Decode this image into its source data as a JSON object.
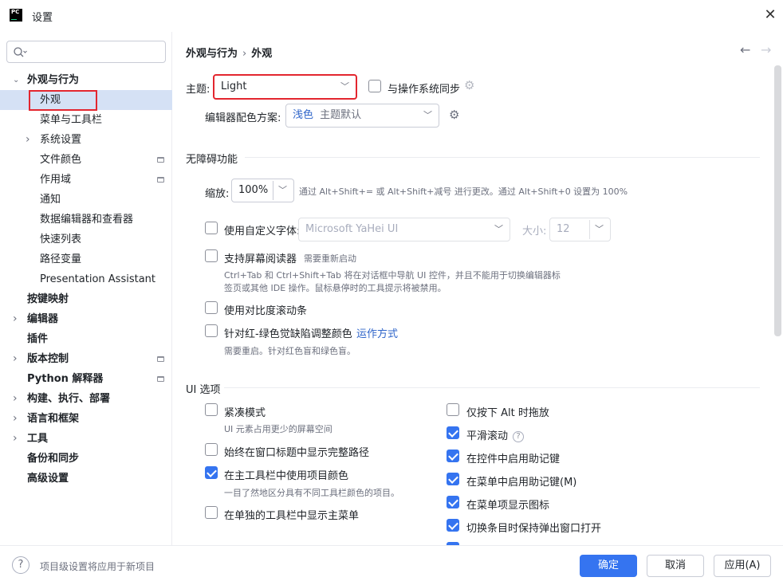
{
  "window": {
    "app_logo": "PC",
    "title": "设置",
    "close": "✕"
  },
  "search": {
    "placeholder": ""
  },
  "tree": [
    {
      "label": "外观与行为",
      "level": 0,
      "chevron": "expanded"
    },
    {
      "label": "外观",
      "level": 1,
      "selected": true
    },
    {
      "label": "菜单与工具栏",
      "level": 1
    },
    {
      "label": "系统设置",
      "level": 1,
      "chevron": "collapsed"
    },
    {
      "label": "文件颜色",
      "level": 1,
      "project_icon": true
    },
    {
      "label": "作用域",
      "level": 1,
      "project_icon": true
    },
    {
      "label": "通知",
      "level": 1
    },
    {
      "label": "数据编辑器和查看器",
      "level": 1
    },
    {
      "label": "快速列表",
      "level": 1
    },
    {
      "label": "路径变量",
      "level": 1
    },
    {
      "label": "Presentation Assistant",
      "level": 1
    },
    {
      "label": "按键映射",
      "level": 0
    },
    {
      "label": "编辑器",
      "level": 0,
      "chevron": "collapsed"
    },
    {
      "label": "插件",
      "level": 0
    },
    {
      "label": "版本控制",
      "level": 0,
      "chevron": "collapsed",
      "project_icon": true
    },
    {
      "label": "Python 解释器",
      "level": 0,
      "project_icon": true
    },
    {
      "label": "构建、执行、部署",
      "level": 0,
      "chevron": "collapsed"
    },
    {
      "label": "语言和框架",
      "level": 0,
      "chevron": "collapsed"
    },
    {
      "label": "工具",
      "level": 0,
      "chevron": "collapsed"
    },
    {
      "label": "备份和同步",
      "level": 0
    },
    {
      "label": "高级设置",
      "level": 0
    }
  ],
  "breadcrumb": {
    "parent": "外观与行为",
    "separator": "›",
    "current": "外观"
  },
  "nav": {
    "back": "←",
    "forward": "→"
  },
  "theme": {
    "label": "主题:",
    "value": "Light",
    "sync_label": "与操作系统同步",
    "sync_checked": false
  },
  "editor_scheme": {
    "label": "编辑器配色方案:",
    "value_prefix": "浅色",
    "value_suffix": "主题默认"
  },
  "accessibility": {
    "title": "无障碍功能",
    "zoom_label": "缩放:",
    "zoom_value": "100%",
    "zoom_hint": "通过 Alt+Shift+= 或 Alt+Shift+减号 进行更改。通过 Alt+Shift+0 设置为 100%",
    "custom_font": {
      "label": "使用自定义字体:",
      "checked": false,
      "font": "Microsoft YaHei UI",
      "size_label": "大小:",
      "size": "12"
    },
    "screen_reader": {
      "label": "支持屏幕阅读器",
      "checked": false,
      "restart_hint": "需要重新启动",
      "hint_line1": "Ctrl+Tab 和 Ctrl+Shift+Tab 将在对话框中导航 UI 控件，并且不能用于切换编辑器标",
      "hint_line2": "签页或其他 IDE 操作。鼠标悬停时的工具提示将被禁用。"
    },
    "contrast_scrollbars": {
      "label": "使用对比度滚动条",
      "checked": false
    },
    "color_deficiency": {
      "label": "针对红-绿色觉缺陷调整颜色",
      "checked": false,
      "link": "运作方式",
      "hint": "需要重启。针对红色盲和绿色盲。"
    }
  },
  "ui_options": {
    "title": "UI 选项",
    "left": [
      {
        "label": "紧凑模式",
        "checked": false,
        "hint": "UI 元素占用更少的屏幕空间"
      },
      {
        "label": "始终在窗口标题中显示完整路径",
        "checked": false
      },
      {
        "label": "在主工具栏中使用项目颜色",
        "checked": true,
        "hint": "一目了然地区分具有不同工具栏颜色的项目。"
      },
      {
        "label": "在单独的工具栏中显示主菜单",
        "checked": false
      }
    ],
    "right": [
      {
        "label": "仅按下 Alt 时拖放",
        "checked": false
      },
      {
        "label": "平滑滚动",
        "checked": true,
        "help": "?"
      },
      {
        "label": "在控件中启用助记键",
        "checked": true
      },
      {
        "label": "在菜单中启用助记键(M)",
        "checked": true
      },
      {
        "label": "在菜单项显示图标",
        "checked": true
      },
      {
        "label": "切换条目时保持弹出窗口打开",
        "checked": true
      }
    ]
  },
  "footer": {
    "help": "?",
    "text": "项目级设置将应用于新项目",
    "ok": "确定",
    "cancel": "取消",
    "apply": "应用(A)"
  },
  "colors": {
    "accent": "#3574f0",
    "highlight_box": "#e3262f",
    "selection": "#d5e1f5",
    "link": "#2f65ca"
  }
}
